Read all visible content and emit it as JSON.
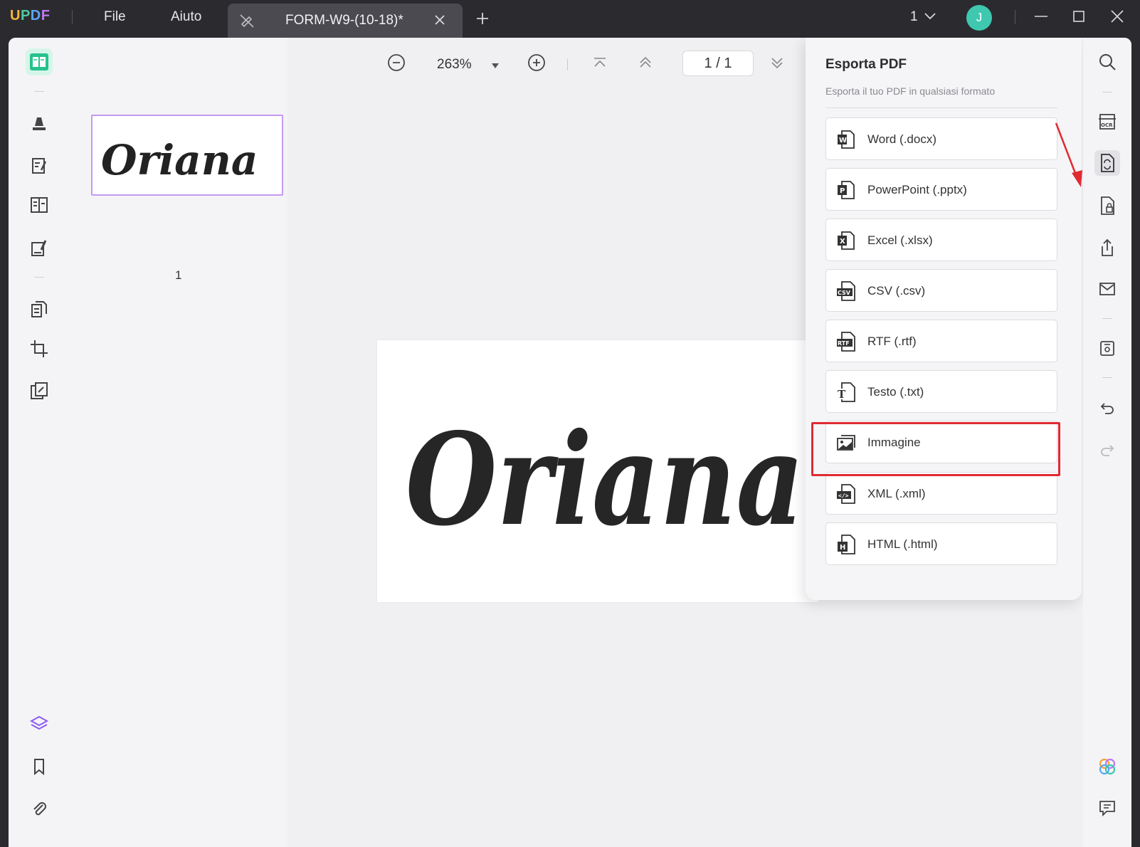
{
  "app": {
    "logo": {
      "u": "U",
      "p": "P",
      "d": "D",
      "f": "F"
    },
    "menu": {
      "file": "File",
      "help": "Aiuto"
    },
    "tab_title": "FORM-W9-(10-18)*",
    "page_count": "1",
    "avatar_initial": "J"
  },
  "toolbar": {
    "zoom": "263%",
    "page_indicator": "1  /  1"
  },
  "thumbnails": {
    "page_number": "1",
    "signature_text": "Oriana"
  },
  "document": {
    "signature_text": "Oriana"
  },
  "export_panel": {
    "title": "Esporta PDF",
    "subtitle": "Esporta il tuo PDF in qualsiasi formato",
    "items": [
      {
        "label": "Word (.docx)",
        "icon": "word-icon"
      },
      {
        "label": "PowerPoint (.pptx)",
        "icon": "powerpoint-icon"
      },
      {
        "label": "Excel (.xlsx)",
        "icon": "excel-icon"
      },
      {
        "label": "CSV (.csv)",
        "icon": "csv-icon"
      },
      {
        "label": "RTF (.rtf)",
        "icon": "rtf-icon"
      },
      {
        "label": "Testo (.txt)",
        "icon": "text-icon"
      },
      {
        "label": "Immagine",
        "icon": "image-icon"
      },
      {
        "label": "XML (.xml)",
        "icon": "xml-icon"
      },
      {
        "label": "HTML (.html)",
        "icon": "html-icon"
      }
    ],
    "highlighted_item": "Immagine"
  },
  "colors": {
    "titlebar": "#2b2b2f",
    "accent_green": "#3fc7b0",
    "highlight_red": "#e02a32",
    "thumb_border": "#c49af4"
  }
}
